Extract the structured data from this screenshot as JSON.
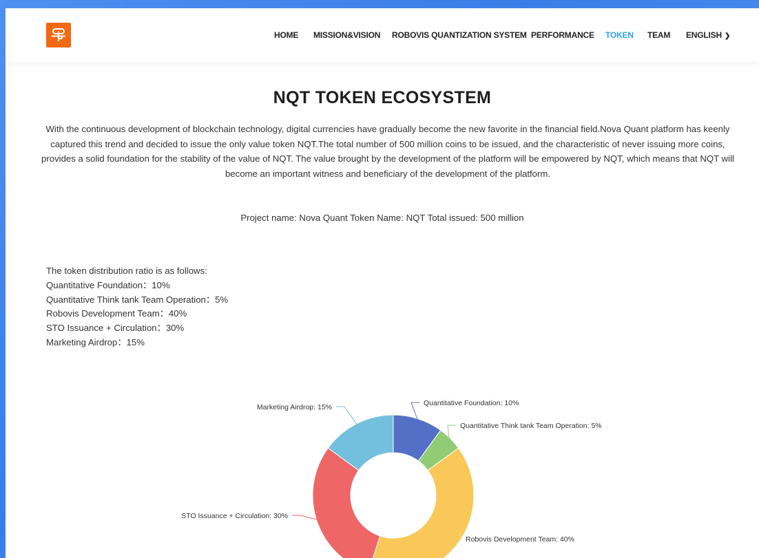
{
  "nav": {
    "home": "HOME",
    "mission": "MISSION&VISION",
    "robovis": "ROBOVIS QUANTIZATION SYSTEM",
    "performance": "PERFORMANCE",
    "token": "TOKEN",
    "team": "TEAM",
    "language": "ENGLISH",
    "active_color": "#2fa3e0"
  },
  "logo": {
    "icon": "brand-logo-icon",
    "color": "#f26a12"
  },
  "page": {
    "title": "NQT TOKEN ECOSYSTEM",
    "intro": "With the continuous development of blockchain technology, digital currencies have gradually become the new favorite in the financial field.Nova Quant platform has keenly captured this trend and decided to issue the only value token NQT.The total number of 500 million coins to be issued, and the characteristic of never issuing more coins, provides a solid foundation for the stability of the value of NQT. The value brought by the development of the platform will be empowered by NQT, which means that NQT will become an important witness and beneficiary of the development of the platform.",
    "project_line": "Project name: Nova Quant  Token Name: NQT  Total issued: 500 million"
  },
  "distribution": {
    "heading": "The token distribution ratio is as follows:",
    "items": [
      "Quantitative Foundation：10%",
      "Quantitative Think tank Team Operation：5%",
      "Robovis Development Team：40%",
      "STO Issuance + Circulation：30%",
      "Marketing Airdrop：15%"
    ]
  },
  "chart_data": {
    "type": "pie",
    "variant": "donut",
    "slices": [
      {
        "label": "Quantitative Foundation: 10%",
        "value": 10,
        "color": "#5470c6"
      },
      {
        "label": "Quantitative Think tank Team Operation: 5%",
        "value": 5,
        "color": "#91cc75"
      },
      {
        "label": "Robovis Development Team: 40%",
        "value": 40,
        "color": "#fac858"
      },
      {
        "label": "STO Issuance + Circulation: 30%",
        "value": 30,
        "color": "#ee6666"
      },
      {
        "label": "Marketing Airdrop: 15%",
        "value": 15,
        "color": "#73c0de"
      }
    ]
  }
}
